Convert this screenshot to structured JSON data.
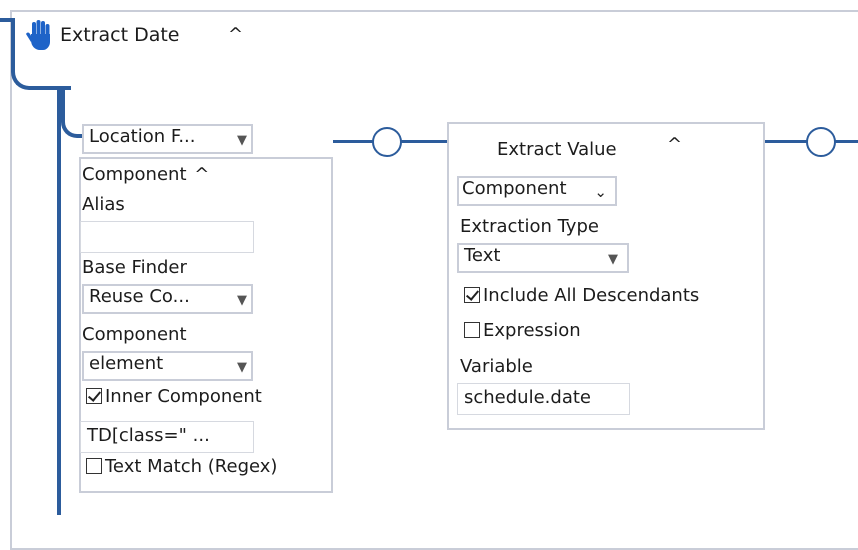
{
  "step": {
    "title": "Extract Date",
    "collapse_caret": "^",
    "icon": "hand-icon"
  },
  "locator": {
    "type_dropdown": "Location F...",
    "section_title": "Component",
    "section_caret": "^",
    "alias_label": "Alias",
    "alias_value": "",
    "base_finder_label": "Base Finder",
    "base_finder_value": "Reuse Co...",
    "component_label": "Component",
    "component_value": "element",
    "inner_component_label": "Inner Component",
    "inner_component_checked": true,
    "selector_value": "TD[class=\" ...",
    "text_match_label": "Text Match (Regex)",
    "text_match_checked": false
  },
  "extract": {
    "title": "Extract Value",
    "title_caret": "^",
    "component_dropdown": "Component",
    "extraction_type_label": "Extraction Type",
    "extraction_type_value": "Text",
    "include_descendants_label": "Include All Descendants",
    "include_descendants_checked": true,
    "expression_label": "Expression",
    "expression_checked": false,
    "variable_label": "Variable",
    "variable_value": "schedule.date"
  },
  "colors": {
    "connector": "#2c5c9c",
    "border": "#c9cdd8"
  }
}
